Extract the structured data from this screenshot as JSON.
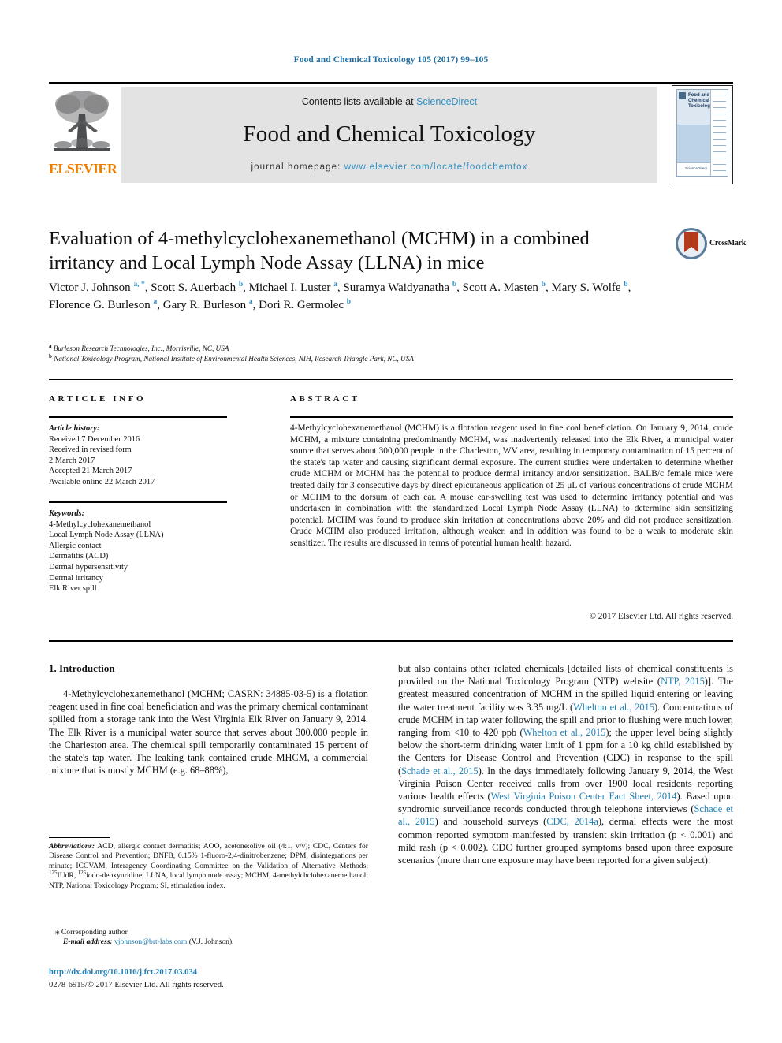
{
  "running_head": "Food and Chemical Toxicology 105 (2017) 99–105",
  "masthead": {
    "contents_prefix": "Contents lists available at ",
    "sciencedirect": "ScienceDirect",
    "journal_title": "Food and Chemical Toxicology",
    "homepage_prefix": "journal homepage: ",
    "homepage_url": "www.elsevier.com/locate/foodchemtox",
    "publisher": "ELSEVIER",
    "cover": {
      "title": "Food and Chemical Toxicology",
      "footer": "ScienceDirect"
    }
  },
  "article": {
    "title": "Evaluation of 4-methylcyclohexanemethanol (MCHM) in a combined irritancy and Local Lymph Node Assay (LLNA) in mice",
    "crossmark_label": "CrossMark",
    "authors_html": "Victor J. Johnson <sup>a, *</sup>, Scott S. Auerbach <sup>b</sup>, Michael I. Luster <sup>a</sup>, Suramya Waidyanatha <sup>b</sup>, Scott A. Masten <sup>b</sup>, Mary S. Wolfe <sup>b</sup>, Florence G. Burleson <sup>a</sup>, Gary R. Burleson <sup>a</sup>, Dori R. Germolec <sup>b</sup>",
    "affiliations": [
      {
        "marker": "a",
        "text": "Burleson Research Technologies, Inc., Morrisville, NC, USA"
      },
      {
        "marker": "b",
        "text": "National Toxicology Program, National Institute of Environmental Health Sciences, NIH, Research Triangle Park, NC, USA"
      }
    ]
  },
  "info_panel": {
    "info_heading": "ARTICLE INFO",
    "abstract_heading": "ABSTRACT",
    "history_label": "Article history:",
    "history_lines": [
      "Received 7 December 2016",
      "Received in revised form",
      "2 March 2017",
      "Accepted 21 March 2017",
      "Available online 22 March 2017"
    ],
    "keywords_label": "Keywords:",
    "keywords": [
      "4-Methylcyclohexanemethanol",
      "Local Lymph Node Assay (LLNA)",
      "Allergic contact",
      "Dermatitis (ACD)",
      "Dermal hypersensitivity",
      "Dermal irritancy",
      "Elk River spill"
    ],
    "abstract": "4-Methylcyclohexanemethanol (MCHM) is a flotation reagent used in fine coal beneficiation. On January 9, 2014, crude MCHM, a mixture containing predominantly MCHM, was inadvertently released into the Elk River, a municipal water source that serves about 300,000 people in the Charleston, WV area, resulting in temporary contamination of 15 percent of the state's tap water and causing significant dermal exposure. The current studies were undertaken to determine whether crude MCHM or MCHM has the potential to produce dermal irritancy and/or sensitization. BALB/c female mice were treated daily for 3 consecutive days by direct epicutaneous application of 25 μL of various concentrations of crude MCHM or MCHM to the dorsum of each ear. A mouse ear-swelling test was used to determine irritancy potential and was undertaken in combination with the standardized Local Lymph Node Assay (LLNA) to determine skin sensitizing potential. MCHM was found to produce skin irritation at concentrations above 20% and did not produce sensitization. Crude MCHM also produced irritation, although weaker, and in addition was found to be a weak to moderate skin sensitizer. The results are discussed in terms of potential human health hazard.",
    "copyright": "© 2017 Elsevier Ltd. All rights reserved."
  },
  "body": {
    "section_number_title": "1. Introduction",
    "left_paragraph_html": "4-Methylcyclohexanemethanol (MCHM; CASRN: 34885-03-5) is a flotation reagent used in fine coal beneficiation and was the primary chemical contaminant spilled from a storage tank into the West Virginia Elk River on January 9, 2014. The Elk River is a municipal water source that serves about 300,000 people in the Charleston area. The chemical spill temporarily contaminated 15 percent of the state's tap water. The leaking tank contained crude MHCM, a commercial mixture that is mostly MCHM (e.g. 68–88%),",
    "right_paragraph_html": "but also contains other related chemicals [detailed lists of chemical constituents is provided on the National Toxicology Program (NTP) website (<span class=\"ref\">NTP, 2015</span>)]. The greatest measured concentration of MCHM in the spilled liquid entering or leaving the water treatment facility was 3.35 mg/L (<span class=\"ref\">Whelton et al., 2015</span>). Concentrations of crude MCHM in tap water following the spill and prior to flushing were much lower, ranging from &lt;10 to 420 ppb (<span class=\"ref\">Whelton et al., 2015</span>); the upper level being slightly below the short-term drinking water limit of 1 ppm for a 10 kg child established by the Centers for Disease Control and Prevention (CDC) in response to the spill (<span class=\"ref\">Schade et al., 2015</span>). In the days immediately following January 9, 2014, the West Virginia Poison Center received calls from over 1900 local residents reporting various health effects (<span class=\"ref\">West Virginia Poison Center Fact Sheet, 2014</span>). Based upon syndromic surveillance records conducted through telephone interviews (<span class=\"ref\">Schade et al., 2015</span>) and household surveys (<span class=\"ref\">CDC, 2014a</span>), dermal effects were the most common reported symptom manifested by transient skin irritation (p &lt; 0.001) and mild rash (p &lt; 0.002). CDC further grouped symptoms based upon three exposure scenarios (more than one exposure may have been reported for a given subject):"
  },
  "footnotes": {
    "abbreviations_label": "Abbreviations:",
    "abbreviations_html": "ACD, allergic contact dermatitis; AOO, acetone:olive oil (4:1, v/v); CDC, Centers for Disease Control and Prevention; DNFB, 0.15% 1-fluoro-2,4-dinitrobenzene; DPM, disintegrations per minute; ICCVAM, Interagency Coordinating Committee on the Validation of Alternative Methods; <sup>125</sup>IUdR, <sup>125</sup>iodo-deoxyuridine; LLNA, local lymph node assay; MCHM, 4-methylchclohexanemethanol; NTP, National Toxicology Program; SI, stimulation index.",
    "corresponding": "Corresponding author.",
    "email_label": "E-mail address:",
    "email": "vjohnson@brt-labs.com",
    "email_suffix": "(V.J. Johnson).",
    "doi": "http://dx.doi.org/10.1016/j.fct.2017.03.034",
    "issn_line": "0278-6915/© 2017 Elsevier Ltd. All rights reserved."
  },
  "colors": {
    "link": "#1d7fb5",
    "header_blue": "#1c6ea4",
    "elsevier_orange": "#ef7d00",
    "masthead_gray": "#e3e3e3"
  }
}
